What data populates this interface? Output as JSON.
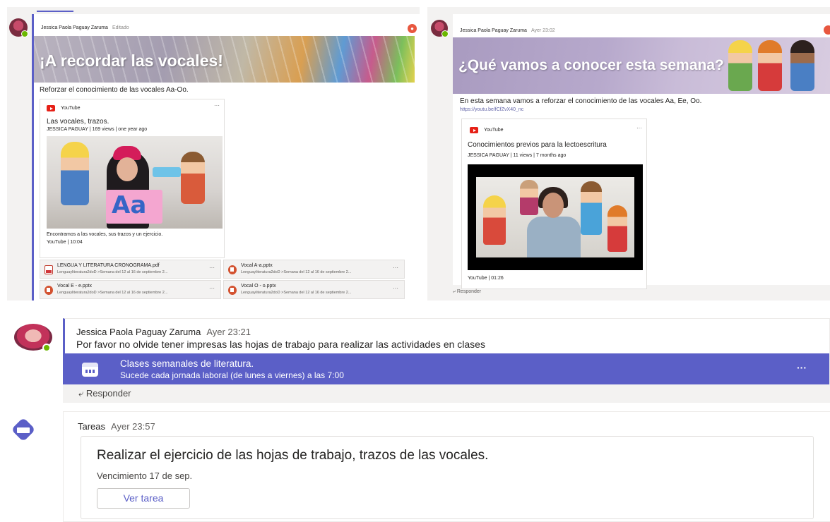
{
  "post_a": {
    "author": "Jessica Paola Paguay Zaruma",
    "meta": "Editado",
    "banner_title": "¡A recordar las vocales!",
    "subject": "Reforzar el conocimiento de las vocales Aa-Oo.",
    "video": {
      "source": "YouTube",
      "title": "Las vocales, trazos.",
      "byline": "JESSICA PAGUAY | 169 views | one year ago",
      "thumb_sign": "Aa",
      "description": "Encontramos a las vocales, sus trazos y un ejercicio.",
      "footer": "YouTube | 10:04",
      "more": "···"
    },
    "files": [
      {
        "name": "LENGUA Y LITERATURA CRONOGRAMA.pdf",
        "path": "Lenguayliteratura2doD >Semana del 12 al 16 de septiembre 2...",
        "type": "pdf",
        "more": "···"
      },
      {
        "name": "Vocal A-a.pptx",
        "path": "Lenguayliteratura2doD >Semana del 12 al 16 de septiembre 2...",
        "type": "pptx",
        "more": "···"
      },
      {
        "name": "Vocal E - e.pptx",
        "path": "Lenguayliteratura2doD >Semana del 12 al 16 de septiembre 2...",
        "type": "pptx",
        "more": "···"
      },
      {
        "name": "Vocal O - o.pptx",
        "path": "Lenguayliteratura2doD >Semana del 12 al 16 de septiembre 2...",
        "type": "pptx",
        "more": "···"
      }
    ]
  },
  "post_b": {
    "author": "Jessica Paola Paguay Zaruma",
    "meta": "Ayer 23:02",
    "banner_title": "¿Qué vamos a conocer esta semana?",
    "subject": "En esta semana vamos a reforzar el conocimiento de las vocales Aa, Ee, Oo.",
    "link": "https://youtu.be/fCfZvX40_nc",
    "video": {
      "source": "YouTube",
      "title": "Conocimientos previos para la lectoescritura",
      "byline": "JESSICA PAGUAY | 11 views | 7 months ago",
      "footer": "YouTube | 01:26",
      "more": "···"
    },
    "reply": "Responder"
  },
  "post_c": {
    "author": "Jessica Paola Paguay Zaruma",
    "meta": "Ayer 23:21",
    "message": "Por favor no olvide tener impresas las hojas de trabajo para realizar las actividades en clases",
    "event": {
      "title": "Clases semanales de literatura.",
      "subtitle": "Sucede cada jornada laboral (de lunes a viernes) a las 7:00",
      "more": "···"
    },
    "reply": "Responder"
  },
  "post_d": {
    "author": "Tareas",
    "meta": "Ayer 23:57",
    "task": {
      "title": "Realizar el ejercicio de las hojas de trabajo, trazos de las vocales.",
      "due": "Vencimiento 17 de sep.",
      "button": "Ver tarea"
    }
  },
  "colors": {
    "accent": "#5b5fc7",
    "presence": "#6bb700",
    "youtube": "#e62117",
    "powerpoint": "#d35230"
  }
}
